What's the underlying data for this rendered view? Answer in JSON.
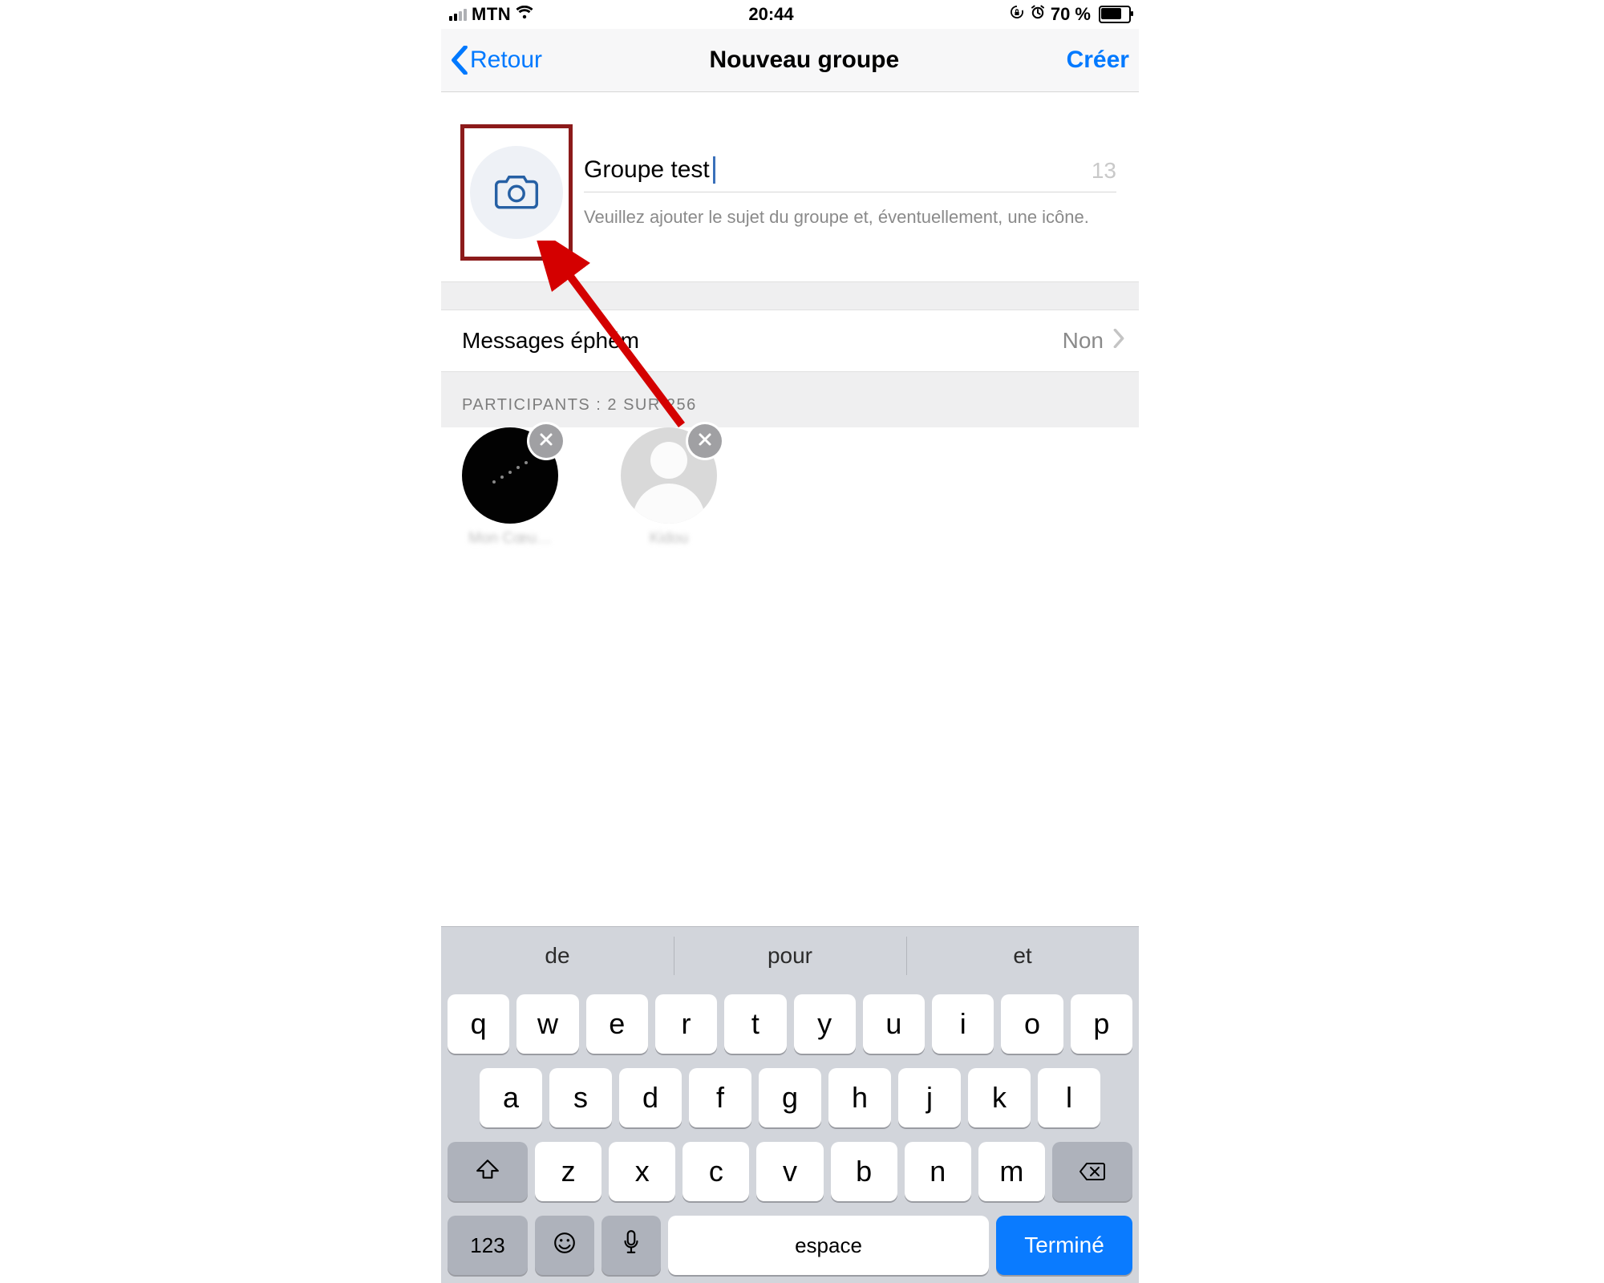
{
  "status": {
    "carrier": "MTN",
    "time": "20:44",
    "battery_text": "70 %"
  },
  "nav": {
    "back": "Retour",
    "title": "Nouveau groupe",
    "action": "Créer"
  },
  "subject": {
    "value": "Groupe test",
    "remaining": "13",
    "hint": "Veuillez ajouter le sujet du groupe et, éventuellement, une icône."
  },
  "settings": {
    "disappearing": {
      "label": "Messages éphém",
      "value": "Non"
    }
  },
  "participants": {
    "header": "PARTICIPANTS : 2 SUR 256",
    "items": [
      {
        "name": "Mon Cœu…"
      },
      {
        "name": "Kidou"
      }
    ]
  },
  "keyboard": {
    "suggestions": [
      "de",
      "pour",
      "et"
    ],
    "row1": [
      "q",
      "w",
      "e",
      "r",
      "t",
      "y",
      "u",
      "i",
      "o",
      "p"
    ],
    "row2": [
      "a",
      "s",
      "d",
      "f",
      "g",
      "h",
      "j",
      "k",
      "l"
    ],
    "row3": [
      "z",
      "x",
      "c",
      "v",
      "b",
      "n",
      "m"
    ],
    "numeric": "123",
    "space": "espace",
    "done": "Terminé"
  }
}
